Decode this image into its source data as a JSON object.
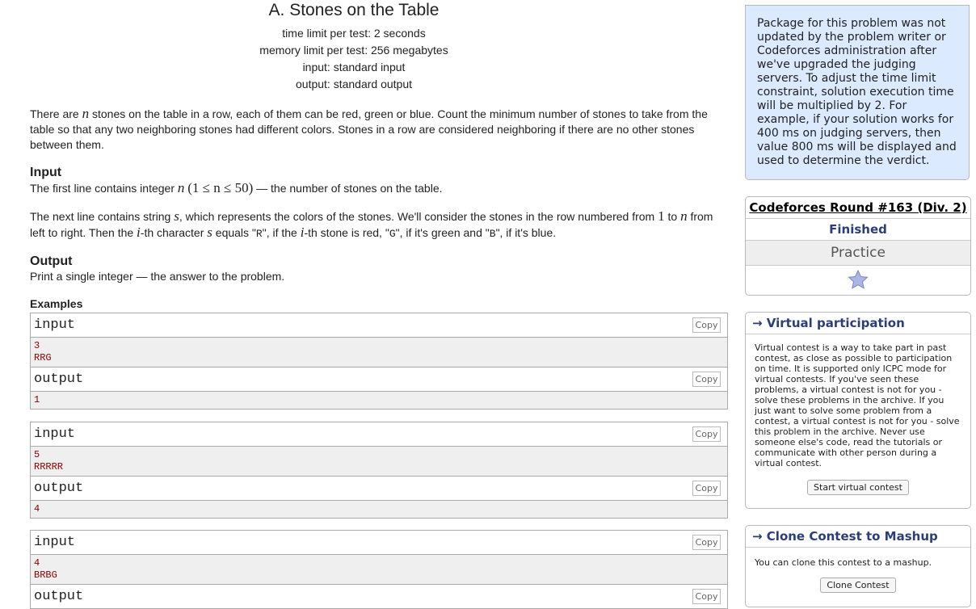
{
  "problem": {
    "title": "A. Stones on the Table",
    "time_limit": "time limit per test: 2 seconds",
    "memory_limit": "memory limit per test: 256 megabytes",
    "input_file": "input: standard input",
    "output_file": "output: standard output",
    "statement_1": "There are ",
    "statement_n": "n",
    "statement_2": " stones on the table in a row, each of them can be red, green or blue. Count the minimum number of stones to take from the table so that any two neighboring stones had different colors. Stones in a row are considered neighboring if there are no other stones between them.",
    "input_title": "Input",
    "input_1": "The first line contains integer ",
    "input_n": "n",
    "input_range": "(1 ≤ n ≤ 50)",
    "input_2": " — the number of stones on the table.",
    "input2_a": "The next line contains string ",
    "input2_s": "s",
    "input2_b": ", which represents the colors of the stones. We'll consider the stones in the row numbered from ",
    "input2_1": "1",
    "input2_c": " to ",
    "input2_n": "n",
    "input2_d": " from left to right. Then the ",
    "input2_i": "i",
    "input2_e": "-th character ",
    "input2_s2": "s",
    "input2_f": " equals \"",
    "input2_R": "R",
    "input2_g": "\", if the ",
    "input2_i2": "i",
    "input2_h": "-th stone is red, \"",
    "input2_G": "G",
    "input2_j": "\", if it's green and \"",
    "input2_B": "B",
    "input2_k": "\", if it's blue.",
    "output_title": "Output",
    "output_text": "Print a single integer — the answer to the problem.",
    "examples_title": "Examples"
  },
  "examples": [
    {
      "input_label": "input",
      "input_lines": [
        "3",
        "RRG"
      ],
      "output_label": "output",
      "output_lines": [
        "1"
      ],
      "copy": "Copy"
    },
    {
      "input_label": "input",
      "input_lines": [
        "5",
        "RRRRR"
      ],
      "output_label": "output",
      "output_lines": [
        "4"
      ],
      "copy": "Copy"
    },
    {
      "input_label": "input",
      "input_lines": [
        "4",
        "BRBG"
      ],
      "output_label": "output",
      "copy": "Copy"
    }
  ],
  "sidebar": {
    "notice": "Package for this problem was not updated by the problem writer or Codeforces administration after we've upgraded the judging servers. To adjust the time limit constraint, solution execution time will be multiplied by 2. For example, if your solution works for 400 ms on judging servers, then value 800 ms will be displayed and used to determine the verdict.",
    "round_name": "Codeforces Round #163 (Div. 2)",
    "round_status": "Finished",
    "round_mode": "Practice",
    "vp_title": "→ Virtual participation",
    "vp_text": "Virtual contest is a way to take part in past contest, as close as possible to participation on time. It is supported only ICPC mode for virtual contests. If you've seen these problems, a virtual contest is not for you - solve these problems in the archive. If you just want to solve some problem from a contest, a virtual contest is not for you - solve this problem in the archive. Never use someone else's code, read the tutorials or communicate with other person during a virtual contest.",
    "vp_button": "Start virtual contest",
    "clone_title": "→ Clone Contest to Mashup",
    "clone_text": "You can clone this contest to a mashup.",
    "clone_button": "Clone Contest"
  },
  "colors": {
    "accent": "#2c3e7a",
    "notice_bg": "#dbeaff",
    "sample_text": "#8b0000"
  }
}
